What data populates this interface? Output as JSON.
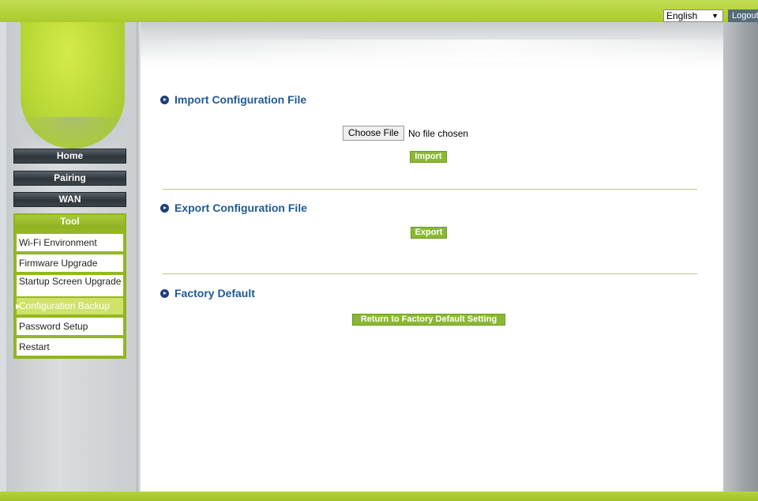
{
  "header": {
    "language": "English",
    "logout_label": "Logout"
  },
  "nav": {
    "home": "Home",
    "pairing": "Pairing",
    "wan": "WAN",
    "tool": "Tool"
  },
  "tool_menu": [
    {
      "label": "Wi-Fi Environment"
    },
    {
      "label": "Firmware Upgrade"
    },
    {
      "label": "Startup Screen Upgrade"
    },
    {
      "label": "Configuration Backup",
      "active": true
    },
    {
      "label": "Password Setup"
    },
    {
      "label": "Restart"
    }
  ],
  "import_section": {
    "title": "Import Configuration File",
    "choose_file_label": "Choose File",
    "file_status": "No file chosen",
    "import_label": "Import"
  },
  "export_section": {
    "title": "Export Configuration File",
    "export_label": "Export"
  },
  "factory_section": {
    "title": "Factory Default",
    "button_label": "Return to Factory Default Setting"
  },
  "colors": {
    "brand_green": "#aacb2a",
    "section_title_blue": "#1f5a96",
    "button_green": "#8ab832"
  }
}
